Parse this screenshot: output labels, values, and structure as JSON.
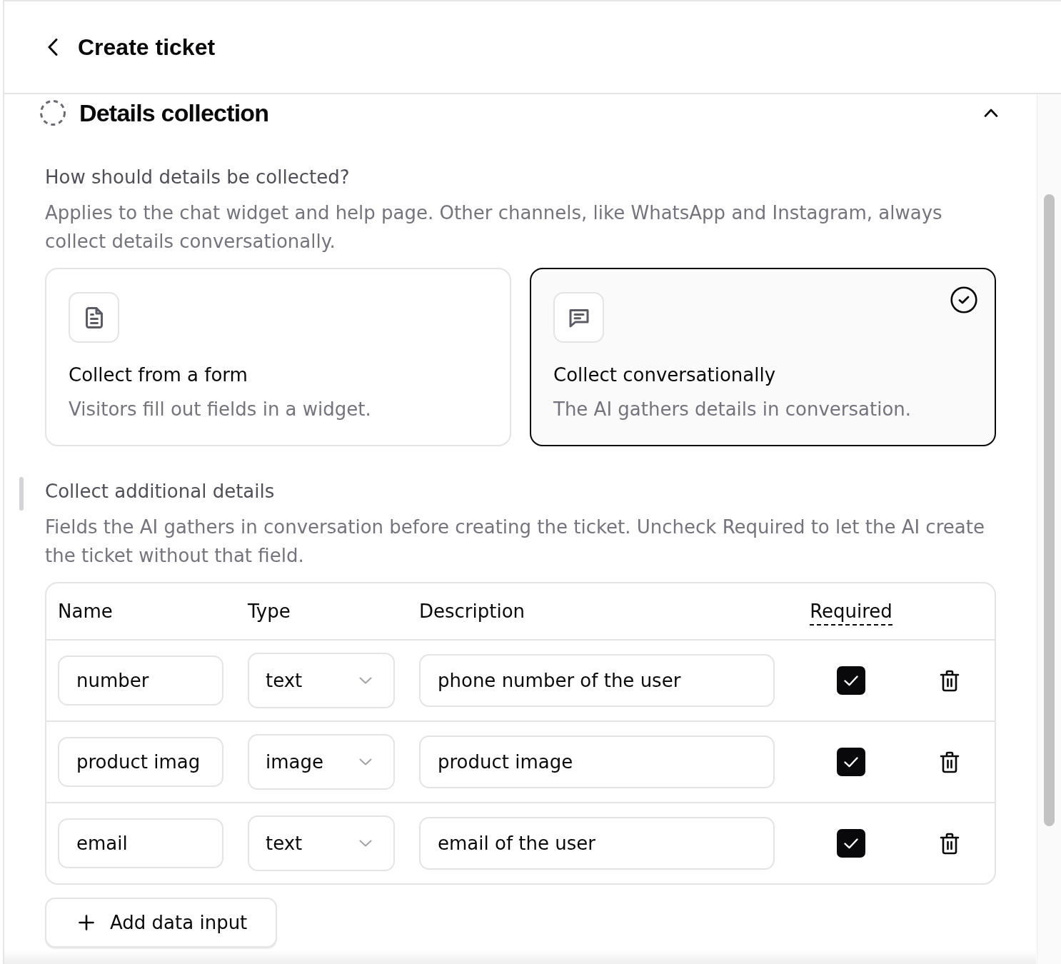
{
  "header": {
    "title": "Create ticket"
  },
  "section": {
    "title": "Details collection",
    "expanded": true
  },
  "collection_method": {
    "question": "How should details be collected?",
    "description": "Applies to the chat widget and help page. Other channels, like WhatsApp and Instagram, always collect details conversationally.",
    "options": [
      {
        "kind": "form",
        "title": "Collect from a form",
        "subtitle": "Visitors fill out fields in a widget.",
        "selected": false
      },
      {
        "kind": "conversation",
        "title": "Collect conversationally",
        "subtitle": "The AI gathers details in conversation.",
        "selected": true
      }
    ]
  },
  "additional_details": {
    "title": "Collect additional details",
    "description": "Fields the AI gathers in conversation before creating the ticket. Uncheck Required to let the AI create the ticket without that field.",
    "table": {
      "columns": [
        {
          "label": "Name",
          "has_hint": false
        },
        {
          "label": "Type",
          "has_hint": false
        },
        {
          "label": "Description",
          "has_hint": false
        },
        {
          "label": "Required",
          "has_hint": true
        }
      ],
      "rows": [
        {
          "name": "number",
          "type": "text",
          "description": "phone number of the user",
          "required": true
        },
        {
          "name": "product imag",
          "type": "image",
          "description": "product image",
          "required": true
        },
        {
          "name": "email",
          "type": "text",
          "description": "email of the user",
          "required": true
        }
      ]
    },
    "add_button": {
      "label": "Add data input"
    }
  }
}
